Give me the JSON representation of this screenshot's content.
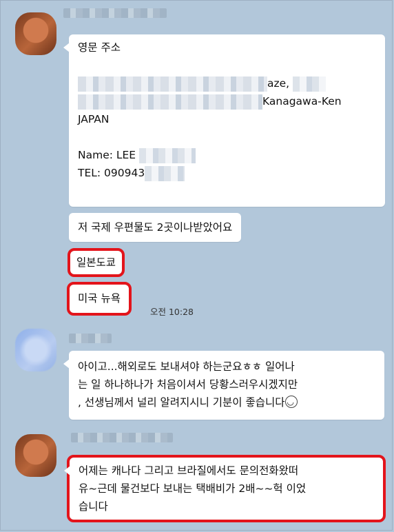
{
  "messages": {
    "m1": {
      "lines": [
        "영문 주소",
        "",
        "aze,",
        "Kanagawa-Ken",
        "JAPAN",
        "",
        "Name: LEE",
        "TEL: 090943"
      ]
    },
    "m2": "저 국제 우편물도 2곳이나받았어요",
    "m3": "일본도쿄",
    "m4": "미국 뉴욕",
    "m4_time": "오전 10:28",
    "m5": {
      "lines": [
        "아이고...해외로도 보내셔야 하는군요ㅎㅎ 일어나",
        "는 일 하나하나가 처음이셔서 당황스러우시겠지만",
        ", 선생님께서 널리 알려지시니 기분이 좋습니다"
      ]
    },
    "m6": {
      "lines": [
        "어제는 캐나다 그리고 브라질에서도 문의전화왔떠",
        "유~근데 물건보다 보내는 택배비가 2배~~헉 이었",
        "습니다"
      ]
    }
  },
  "colors": {
    "background": "#b2c7da",
    "highlight": "#e3141b",
    "bubble": "#ffffff"
  }
}
